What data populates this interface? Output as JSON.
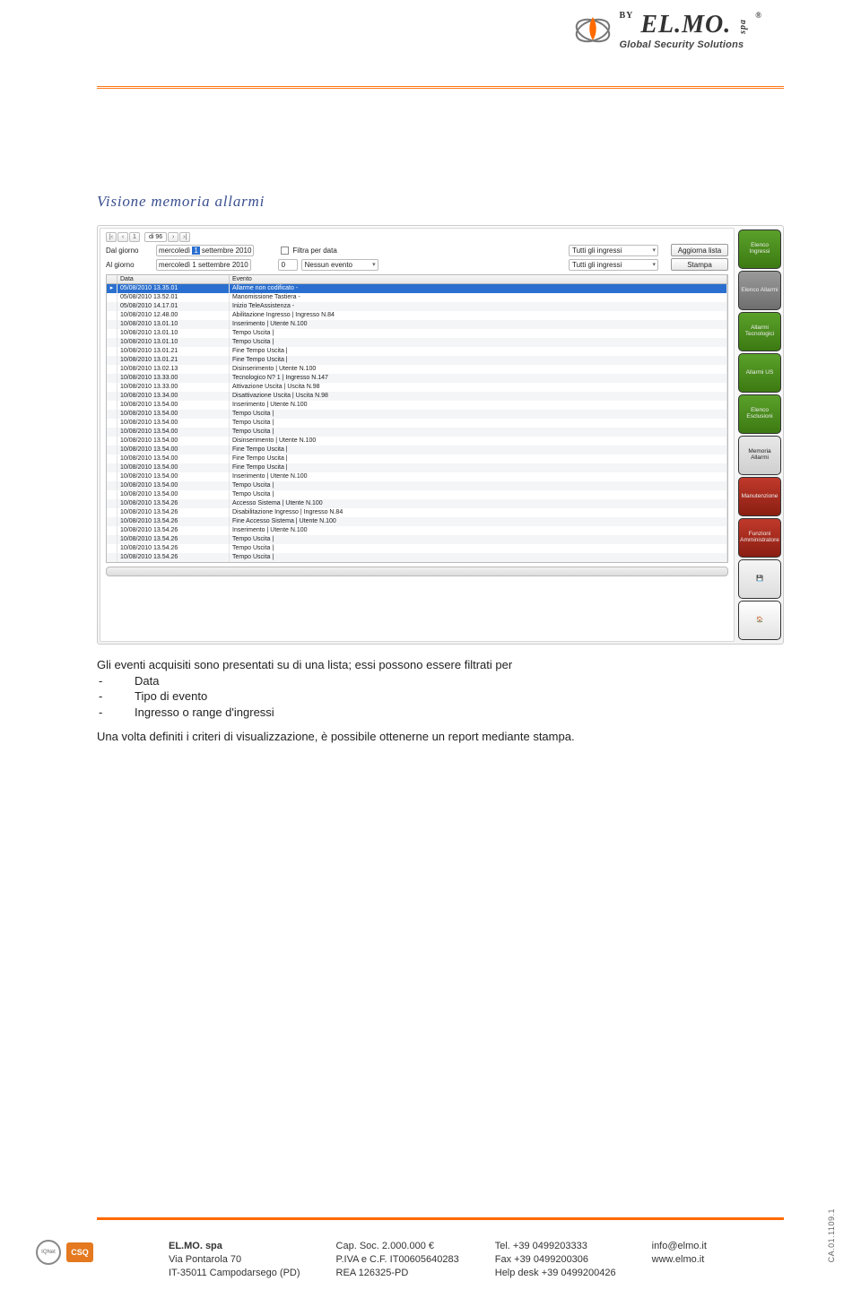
{
  "header": {
    "brand": "EL.MO.",
    "suffix": "spa",
    "tagline": "Global Security Solutions",
    "by": "BY",
    "reg": "®"
  },
  "section_title": "Visione memoria allarmi",
  "filters": {
    "from_label": "Dal giorno",
    "to_label": "Al giorno",
    "weekday": "mercoledì",
    "day_from": "1",
    "month_year": "settembre 2010",
    "day_to": "1",
    "filter_date": "Filtra per data",
    "count": "0",
    "no_event": "Nessun evento",
    "all_in": "Tutti gli ingressi",
    "btn_refresh": "Aggiorna lista",
    "btn_print": "Stampa",
    "record_counter": "di 96",
    "nav": {
      "first": "|‹",
      "prev": "‹",
      "rec": "1",
      "next": "›",
      "last": "›|"
    }
  },
  "grid": {
    "col_date": "Data",
    "col_event": "Evento",
    "rows": [
      {
        "d": "05/08/2010 13.35.01",
        "e": "Allarme non codificato -",
        "sel": true
      },
      {
        "d": "05/08/2010 13.52.01",
        "e": "Manomissione Tastiera -"
      },
      {
        "d": "05/08/2010 14.17.01",
        "e": "Inizio TeleAssistenza -"
      },
      {
        "d": "10/08/2010 12.48.00",
        "e": "Abilitazione Ingresso | Ingresso N.84"
      },
      {
        "d": "10/08/2010 13.01.10",
        "e": "Inserimento | Utente N.100"
      },
      {
        "d": "10/08/2010 13.01.10",
        "e": "Tempo Uscita |"
      },
      {
        "d": "10/08/2010 13.01.10",
        "e": "Tempo Uscita |"
      },
      {
        "d": "10/08/2010 13.01.21",
        "e": "Fine Tempo Uscita |"
      },
      {
        "d": "10/08/2010 13.01.21",
        "e": "Fine Tempo Uscita |"
      },
      {
        "d": "10/08/2010 13.02.13",
        "e": "Disinserimento | Utente N.100"
      },
      {
        "d": "10/08/2010 13.33.00",
        "e": "Tecnologico N? 1 | Ingresso N.147"
      },
      {
        "d": "10/08/2010 13.33.00",
        "e": "Attivazione Uscita | Uscita N.98"
      },
      {
        "d": "10/08/2010 13.34.00",
        "e": "Disattivazione Uscita | Uscita N.98"
      },
      {
        "d": "10/08/2010 13.54.00",
        "e": "Inserimento | Utente N.100"
      },
      {
        "d": "10/08/2010 13.54.00",
        "e": "Tempo Uscita |"
      },
      {
        "d": "10/08/2010 13.54.00",
        "e": "Tempo Uscita |"
      },
      {
        "d": "10/08/2010 13.54.00",
        "e": "Tempo Uscita |"
      },
      {
        "d": "10/08/2010 13.54.00",
        "e": "Disinserimento | Utente N.100"
      },
      {
        "d": "10/08/2010 13.54.00",
        "e": "Fine Tempo Uscita |"
      },
      {
        "d": "10/08/2010 13.54.00",
        "e": "Fine Tempo Uscita |"
      },
      {
        "d": "10/08/2010 13.54.00",
        "e": "Fine Tempo Uscita |"
      },
      {
        "d": "10/08/2010 13.54.00",
        "e": "Inserimento | Utente N.100"
      },
      {
        "d": "10/08/2010 13.54.00",
        "e": "Tempo Uscita |"
      },
      {
        "d": "10/08/2010 13.54.00",
        "e": "Tempo Uscita |"
      },
      {
        "d": "10/08/2010 13.54.26",
        "e": "Accesso Sistema | Utente N.100"
      },
      {
        "d": "10/08/2010 13.54.26",
        "e": "Disabilitazione Ingresso | Ingresso N.84"
      },
      {
        "d": "10/08/2010 13.54.26",
        "e": "Fine Accesso Sistema | Utente N.100"
      },
      {
        "d": "10/08/2010 13.54.26",
        "e": "Inserimento | Utente N.100"
      },
      {
        "d": "10/08/2010 13.54.26",
        "e": "Tempo Uscita |"
      },
      {
        "d": "10/08/2010 13.54.26",
        "e": "Tempo Uscita |"
      },
      {
        "d": "10/08/2010 13.54.26",
        "e": "Tempo Uscita |"
      }
    ]
  },
  "sidebar": [
    {
      "label": "Elenco Ingressi",
      "cls": "grn"
    },
    {
      "label": "Elenco Allarmi",
      "cls": "gry"
    },
    {
      "label": "Allarmi Tecnologici",
      "cls": "grn"
    },
    {
      "label": "Allarmi US",
      "cls": "grn"
    },
    {
      "label": "Elenco Esclusioni",
      "cls": "grn"
    },
    {
      "label": "Memoria Allarmi",
      "cls": "lgt"
    },
    {
      "label": "Manutenzione",
      "cls": "red"
    },
    {
      "label": "Funzioni Amministratore",
      "cls": "red"
    },
    {
      "label": "💾",
      "cls": "lt2"
    },
    {
      "label": "🏠",
      "cls": "home"
    }
  ],
  "body": {
    "p1": "Gli eventi acquisiti sono presentati su di una lista; essi possono essere filtrati per",
    "b1": "Data",
    "b2": "Tipo di evento",
    "b3": "Ingresso o range d'ingressi",
    "p2": "Una volta definiti i criteri di visualizzazione, è possibile ottenerne un report mediante stampa."
  },
  "footer": {
    "col1": {
      "a": "EL.MO. spa",
      "b": "Via Pontarola 70",
      "c": "IT-35011 Campodarsego (PD)"
    },
    "col2": {
      "a": "Cap. Soc. 2.000.000 €",
      "b": "P.IVA e C.F. IT00605640283",
      "c": "REA 126325-PD"
    },
    "col3": {
      "a": "Tel. +39 0499203333",
      "b": "Fax +39 0499200306",
      "c": "Help desk +39 0499200426"
    },
    "col4": {
      "a": "info@elmo.it",
      "b": "www.elmo.it"
    },
    "doccode": "CA.01.1109.1",
    "badge_csq": "CSQ",
    "badge_iqnet": "IQNet"
  }
}
